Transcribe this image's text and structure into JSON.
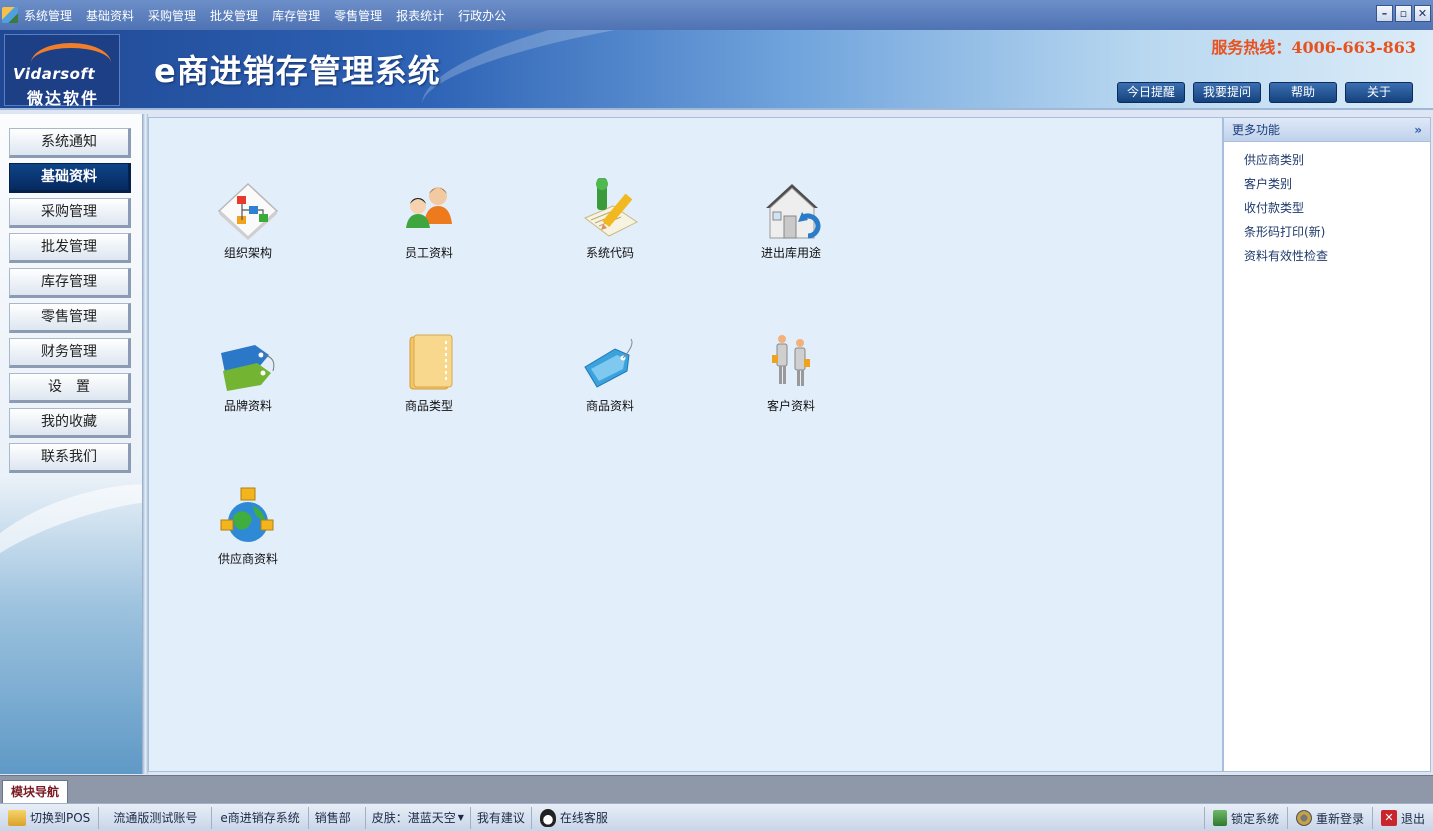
{
  "menubar": {
    "items": [
      "系统管理",
      "基础资料",
      "采购管理",
      "批发管理",
      "库存管理",
      "零售管理",
      "报表统计",
      "行政办公"
    ],
    "window_controls": {
      "minimize": "–",
      "restore": "▫",
      "close": "✕"
    }
  },
  "banner": {
    "logo_en": "Vidarsoft",
    "logo_cn": "微达软件",
    "title": "e商进销存管理系统",
    "hotline": "服务热线：4006-663-863",
    "buttons": [
      "今日提醒",
      "我要提问",
      "帮助",
      "关于"
    ]
  },
  "leftnav": {
    "items": [
      "系统通知",
      "基础资料",
      "采购管理",
      "批发管理",
      "库存管理",
      "零售管理",
      "财务管理",
      "设　置",
      "我的收藏",
      "联系我们"
    ],
    "active_index": 1
  },
  "main": {
    "tiles": [
      {
        "label": "组织架构",
        "icon": "org-chart-icon"
      },
      {
        "label": "员工资料",
        "icon": "employees-icon"
      },
      {
        "label": "系统代码",
        "icon": "system-code-icon"
      },
      {
        "label": "进出库用途",
        "icon": "warehouse-house-icon"
      },
      {
        "label": "品牌资料",
        "icon": "brand-tags-icon"
      },
      {
        "label": "商品类型",
        "icon": "folder-icon"
      },
      {
        "label": "商品资料",
        "icon": "product-tag-icon"
      },
      {
        "label": "客户资料",
        "icon": "customers-icon"
      },
      {
        "label": "供应商资料",
        "icon": "suppliers-globe-icon"
      }
    ]
  },
  "rightpanel": {
    "title": "更多功能",
    "chevron": "»",
    "links": [
      "供应商类别",
      "客户类别",
      "收付款类型",
      "条形码打印(新)",
      "资料有效性检查"
    ]
  },
  "tabstrip": {
    "active_tab": "模块导航"
  },
  "statusbar": {
    "left": [
      {
        "label": "切换到POS",
        "icon": "folder-pos-icon"
      },
      {
        "label": "流通版测试账号"
      },
      {
        "label": "e商进销存系统"
      },
      {
        "label": "销售部"
      },
      {
        "label": "皮肤：湛蓝天空"
      },
      {
        "label": "我有建议"
      },
      {
        "label": "在线客服",
        "icon": "qq-penguin-icon"
      }
    ],
    "right": [
      {
        "label": "锁定系统",
        "icon": "lock-system-icon"
      },
      {
        "label": "重新登录",
        "icon": "relogin-icon"
      },
      {
        "label": "退出",
        "icon": "exit-icon"
      }
    ]
  }
}
